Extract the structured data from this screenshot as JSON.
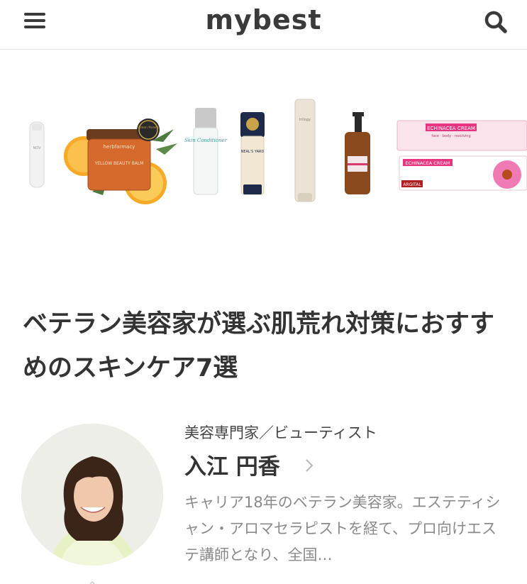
{
  "header": {
    "logo": "mybest",
    "menu_icon": "hamburger-menu-icon",
    "search_icon": "search-icon"
  },
  "hero": {
    "products": [
      {
        "label": "NOV"
      },
      {
        "label": "herbfarmacy",
        "sub": "YELLOW BEAUTY BALM",
        "badge": "Green Parent"
      },
      {
        "label": "Skin Conditioner"
      },
      {
        "label": "NEAL'S YARD"
      },
      {
        "label": "trilogy"
      },
      {
        "label": "pump"
      },
      {
        "label": "ECHINACEA CREAM",
        "sub": "face · body · resolving",
        "brand": "ARGITAL"
      }
    ]
  },
  "article": {
    "title": "ベテラン美容家が選ぶ肌荒れ対策におすすめのスキンケア7選"
  },
  "expert": {
    "role": "美容専門家／ビューティスト",
    "name": "入江 円香",
    "description": "キャリア18年のベテラン美容家。エステティシャン・アロマセラピストを経て、プロ向けエステ講師となり、全国…"
  },
  "colors": {
    "text": "#333333",
    "muted": "#8a8a8a",
    "divider": "#e6e6e6",
    "accent_pink": "#e8357f"
  }
}
